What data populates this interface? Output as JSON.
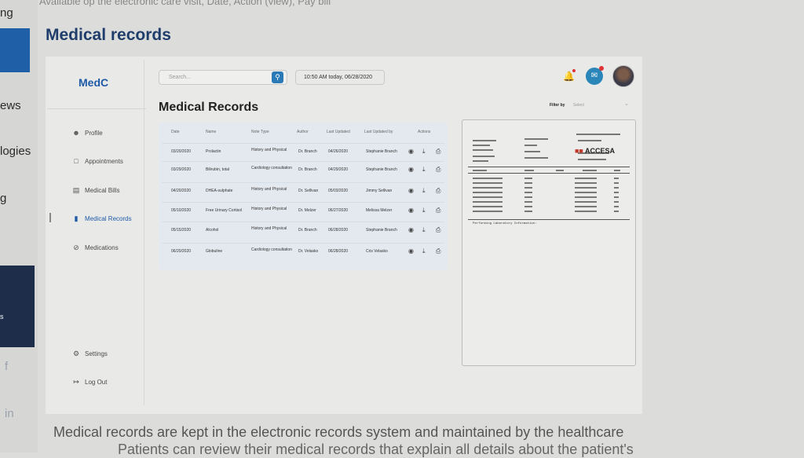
{
  "page": {
    "title": "Medical records",
    "caption_line1": "Medical records are kept in the electronic records system and maintained by the healthcare",
    "caption_line2": "Patients can review their medical records that explain all details about the patient's",
    "top_text": "Avaliable op the electronic care visit, Date, Action (view), Pay bill"
  },
  "left_strip": {
    "texts": [
      "ng",
      "ews",
      "logies",
      "g",
      "s"
    ],
    "social": [
      "f",
      "in"
    ]
  },
  "app": {
    "logo": "MedC",
    "search": {
      "placeholder": "Search..."
    },
    "datetime": "10:50 AM today, 06/28/2020",
    "nav": [
      {
        "label": "Profile",
        "icon": "person-icon"
      },
      {
        "label": "Appointments",
        "icon": "calendar-icon"
      },
      {
        "label": "Medical Bills",
        "icon": "bill-icon"
      },
      {
        "label": "Medical Records",
        "icon": "folder-icon"
      },
      {
        "label": "Medications",
        "icon": "pill-icon"
      }
    ],
    "bottom_nav": [
      {
        "label": "Settings",
        "icon": "gear-icon"
      },
      {
        "label": "Log Out",
        "icon": "logout-icon"
      }
    ],
    "section_title": "Medical Records",
    "filter": {
      "label": "Filter by",
      "value": "Select"
    },
    "table": {
      "columns": [
        "Date",
        "Name",
        "Note Type",
        "Author",
        "Last Updated",
        "Last Updated by",
        "Actions"
      ],
      "rows": [
        [
          "03/20/2020",
          "Prolactin",
          "History and Physical",
          "Dr. Branch",
          "04/26/2020",
          "Stephanie Branch"
        ],
        [
          "03/29/2020",
          "Bilirubin, total",
          "Cardiology consultation",
          "Dr. Branch",
          "04/29/2020",
          "Stephanie Branch"
        ],
        [
          "04/20/2020",
          "DHEA-sulphate",
          "History and Physical",
          "Dr. Sellivan",
          "05/03/2020",
          "Jimmy Sellivan"
        ],
        [
          "05/10/2020",
          "Free Urinary Cortisol",
          "History and Physical",
          "Dr. Melzer",
          "06/27/2020",
          "Melissa Melzer"
        ],
        [
          "05/15/2020",
          "Alcohol",
          "History and Physical",
          "Dr. Branch",
          "06/28/2020",
          "Stephanie Branch"
        ],
        [
          "06/20/2020",
          "Globuline",
          "Cardiology consultation",
          "Dr. Velasko",
          "06/28/2020",
          "Cris Velasko"
        ]
      ]
    },
    "document": {
      "logo": "ACCESA",
      "footer": "Performing Laboratory Information:"
    }
  },
  "colors": {
    "accent": "#1e5aa8",
    "brand_red": "#c0392b",
    "navy": "#1d2d4a"
  }
}
